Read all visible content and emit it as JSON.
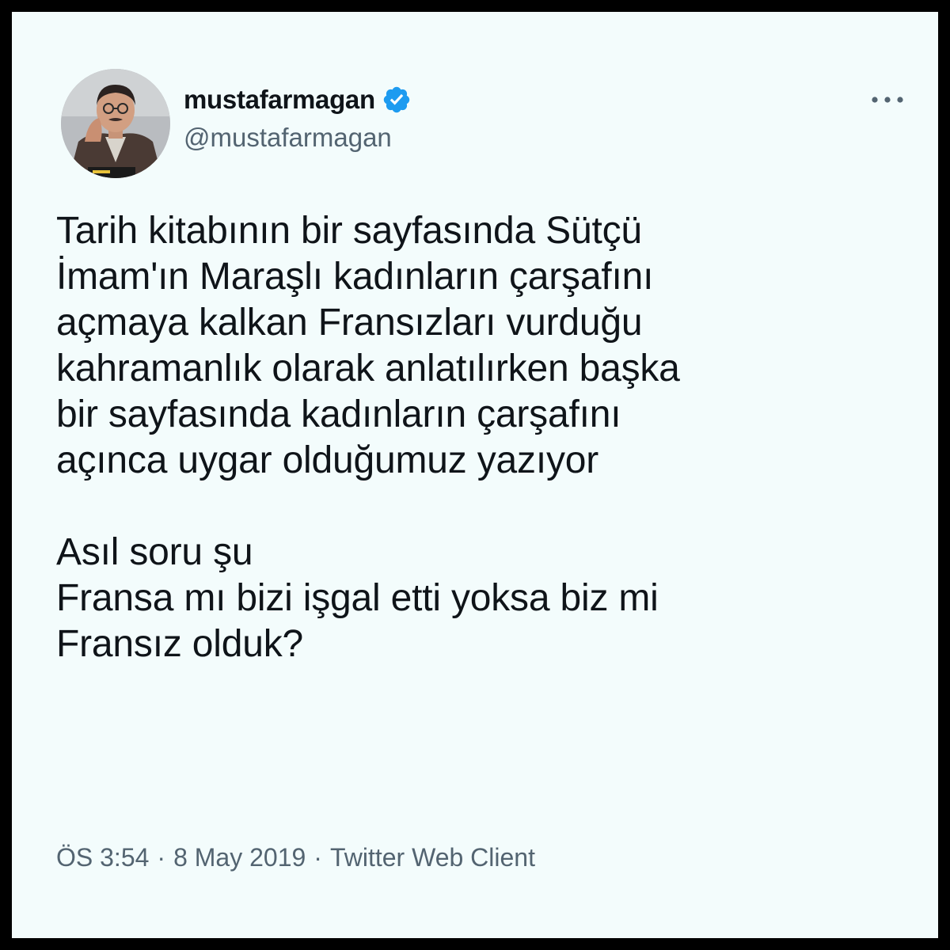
{
  "tweet": {
    "author": {
      "display_name": "mustafarmagan",
      "handle": "@mustafarmagan",
      "verified": true,
      "avatar_icon": "avatar-photo"
    },
    "more_icon": "more-horizontal-icon",
    "text": "Tarih kitabının bir sayfasında Sütçü\nİmam'ın Maraşlı kadınların çarşafını\naçmaya kalkan Fransızları vurduğu\nkahramanlık olarak anlatılırken başka\nbir sayfasında kadınların çarşafını\naçınca uygar olduğumuz yazıyor\n\nAsıl soru şu\nFransa mı bizi işgal etti yoksa biz mi\nFransız olduk?",
    "time": "ÖS 3:54",
    "separator": "·",
    "date": "8 May 2019",
    "source": "Twitter Web Client"
  },
  "colors": {
    "background": "#f3fcfc",
    "outer_border": "#000000",
    "text_primary": "#0f1419",
    "text_secondary": "#536471",
    "verified_blue": "#1d9bf0"
  }
}
